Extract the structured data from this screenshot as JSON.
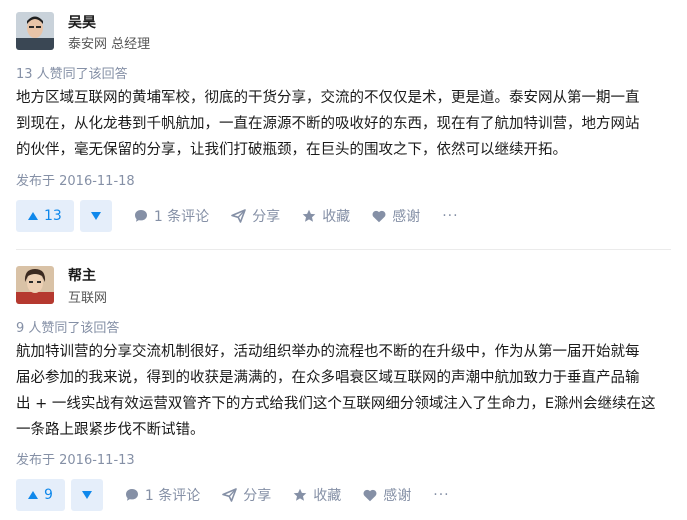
{
  "answers": [
    {
      "author": {
        "name": "吴昊",
        "title": "泰安网 总经理"
      },
      "vote_note": "13 人赞同了该回答",
      "content": "地方区域互联网的黄埔军校，彻底的干货分享，交流的不仅仅是术，更是道。泰安网从第一期一直\n到现在，从化龙巷到千帆航加，一直在源源不断的吸收好的东西，现在有了航加特训营，地方网站\n的伙伴，毫无保留的分享，让我们打破瓶颈，在巨头的围攻之下，依然可以继续开拓。",
      "published": "发布于 2016-11-18",
      "actions": {
        "upvote_count": "13",
        "comment": "1 条评论",
        "share": "分享",
        "collect": "收藏",
        "thanks": "感谢",
        "more": "···"
      }
    },
    {
      "author": {
        "name": "帮主",
        "title": "互联网"
      },
      "vote_note": "9 人赞同了该回答",
      "content": "航加特训营的分享交流机制很好，活动组织举办的流程也不断的在升级中，作为从第一届开始就每\n届必参加的我来说，得到的收获是满满的，在众多唱衰区域互联网的声潮中航加致力于垂直产品输\n出 + 一线实战有效运营双管齐下的方式给我们这个互联网细分领域注入了生命力，E滁州会继续在这\n一条路上跟紧步伐不断试错。",
      "published": "发布于 2016-11-13",
      "actions": {
        "upvote_count": "9",
        "comment": "1 条评论",
        "share": "分享",
        "collect": "收藏",
        "thanks": "感谢",
        "more": "···"
      }
    }
  ],
  "colors": {
    "accent": "#0f88eb",
    "vote_bg": "#e5eefa",
    "meta_text": "#8590a6"
  },
  "icons": [
    "comment-icon",
    "share-icon",
    "star-icon",
    "heart-icon"
  ]
}
